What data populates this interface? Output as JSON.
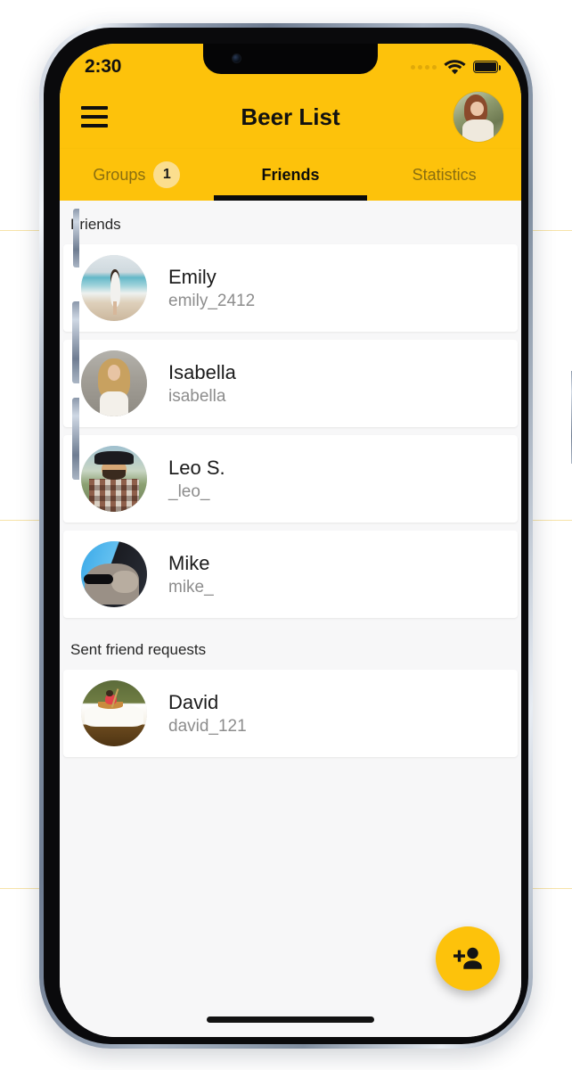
{
  "status_bar": {
    "time": "2:30",
    "signal_icon": "signal-dots-icon",
    "wifi_icon": "wifi-icon",
    "battery_icon": "battery-full-icon"
  },
  "app_bar": {
    "menu_icon": "hamburger-menu-icon",
    "title": "Beer List",
    "avatar_icon": "user-avatar-image"
  },
  "tabs": [
    {
      "label": "Groups",
      "badge": "1",
      "active": false
    },
    {
      "label": "Friends",
      "badge": "",
      "active": true
    },
    {
      "label": "Statistics",
      "badge": "",
      "active": false
    }
  ],
  "sections": [
    {
      "header": "Friends",
      "items": [
        {
          "name": "Emily",
          "handle": "emily_2412",
          "avatar": "emily-avatar"
        },
        {
          "name": "Isabella",
          "handle": "isabella",
          "avatar": "isabella-avatar"
        },
        {
          "name": "Leo S.",
          "handle": "_leo_",
          "avatar": "leo-avatar"
        },
        {
          "name": "Mike",
          "handle": "mike_",
          "avatar": "mike-avatar"
        }
      ]
    },
    {
      "header": "Sent friend requests",
      "items": [
        {
          "name": "David",
          "handle": "david_121",
          "avatar": "david-avatar"
        }
      ]
    }
  ],
  "fab": {
    "icon": "person-add-icon",
    "label": "Add friend"
  },
  "colors": {
    "brand_yellow": "#FDC20B",
    "badge_yellow": "#FBDE8E",
    "page_background": "#F7F7F8",
    "card_background": "#FFFFFF",
    "primary_text": "#1B1B1B",
    "secondary_text": "#8D8D8D",
    "inactive_tab_text": "#8A6E10"
  }
}
